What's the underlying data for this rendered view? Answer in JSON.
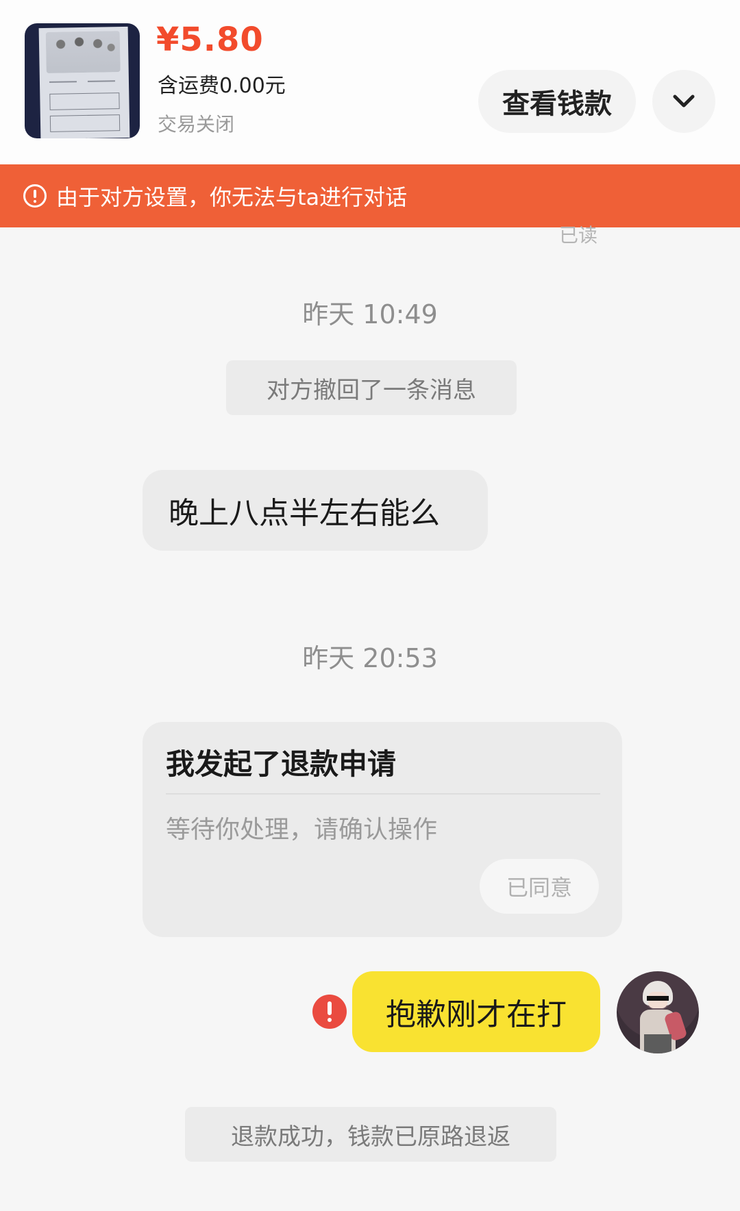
{
  "header": {
    "price": "¥5.80",
    "shipping": "含运费0.00元",
    "trade_status": "交易关闭",
    "view_money_label": "查看钱款",
    "expand_icon": "chevron-down-icon"
  },
  "banner": {
    "icon": "warning-circle-icon",
    "text": "由于对方设置，你无法与ta进行对话",
    "color": "#ef6037"
  },
  "chat": {
    "read_mark": "已读",
    "time_1": "昨天 10:49",
    "recall_notice": "对方撤回了一条消息",
    "incoming_message": "晚上八点半左右能么",
    "time_2": "昨天 20:53",
    "refund_card": {
      "title": "我发起了退款申请",
      "description": "等待你处理，请确认操作",
      "agreed_label": "已同意"
    },
    "outgoing_message": "抱歉刚才在打",
    "outgoing_status_icon": "error-icon",
    "refund_success_notice": "退款成功，钱款已原路退返"
  },
  "colors": {
    "price": "#f24b2c",
    "outgoing_bubble": "#f9e231",
    "incoming_bubble": "#ebebeb",
    "error": "#ea4b40"
  }
}
